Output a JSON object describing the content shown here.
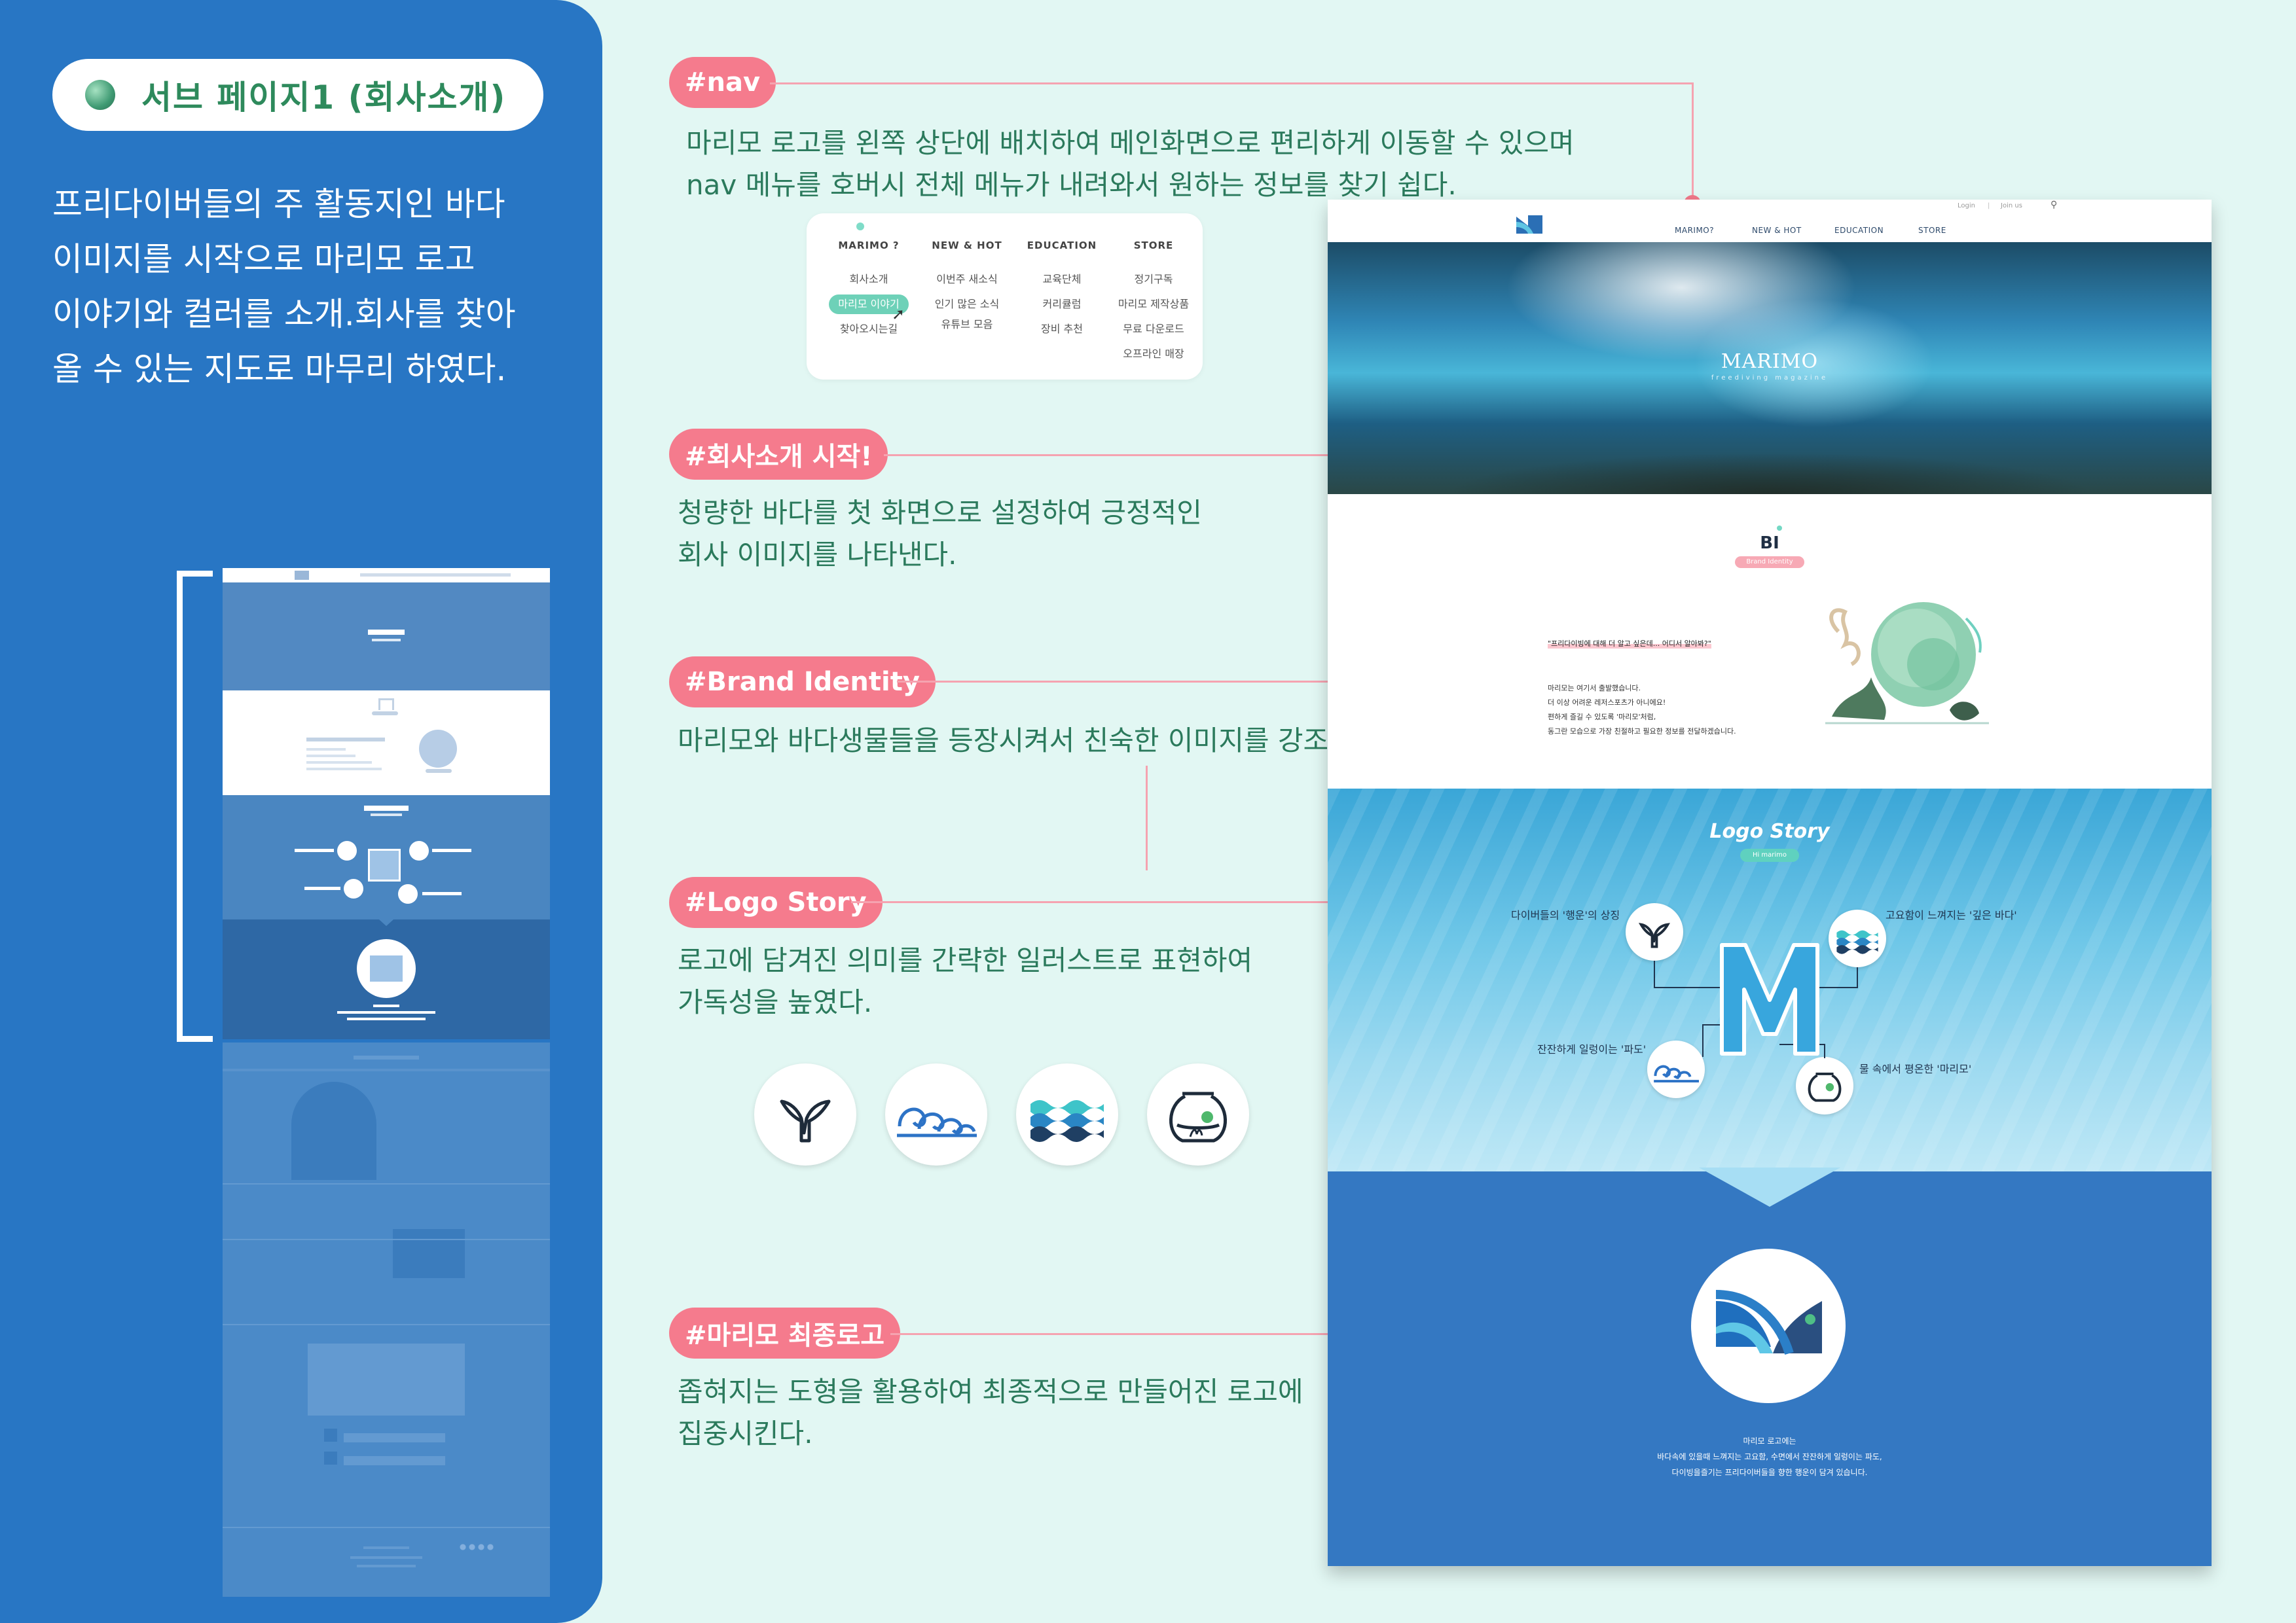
{
  "left": {
    "title": "서브 페이지1 (회사소개)",
    "intro": [
      "프리다이버들의 주 활동지인 바다",
      "이미지를 시작으로 마리모 로고",
      "이야기와 컬러를 소개.회사를 찾아",
      "올 수 있는 지도로 마무리 하였다."
    ]
  },
  "nav": {
    "tag": "#nav",
    "desc": [
      "마리모 로고를 왼쪽 상단에 배치하여 메인화면으로 편리하게 이동할 수 있으며",
      "nav 메뉴를 호버시 전체 메뉴가 내려와서 원하는 정보를 찾기 쉽다."
    ],
    "dropdown": {
      "columns": [
        {
          "head": "MARIMO ?",
          "items": [
            "회사소개",
            "마리모 이야기",
            "찾아오시는길"
          ]
        },
        {
          "head": "NEW & HOT",
          "items": [
            "이번주 새소식",
            "인기 많은 소식",
            "유튜브 모음"
          ]
        },
        {
          "head": "EDUCATION",
          "items": [
            "교육단체",
            "커리큘럼",
            "장비 추천"
          ]
        },
        {
          "head": "STORE",
          "items": [
            "정기구독",
            "마리모 제작상품",
            "무료 다운로드",
            "오프라인 매장"
          ]
        }
      ]
    }
  },
  "intro_section": {
    "tag": "#회사소개 시작!",
    "desc": [
      "청량한 바다를 첫 화면으로 설정하여 긍정적인",
      "회사 이미지를 나타낸다."
    ]
  },
  "brand": {
    "tag": "#Brand Identity",
    "desc": [
      "마리모와 바다생물들을 등장시켜서 친숙한 이미지를 강조."
    ]
  },
  "logo_story": {
    "tag": "#Logo Story",
    "desc": [
      "로고에 담겨진 의미를 간략한 일러스트로 표현하여",
      "가독성을 높였다."
    ],
    "icons": [
      "whale-tail-icon",
      "wave-curl-icon",
      "wave-layers-icon",
      "fishbowl-icon"
    ]
  },
  "final_logo": {
    "tag": "#마리모 최종로고",
    "desc": [
      "좁혀지는 도형을 활용하여 최종적으로 만들어진 로고에",
      "집중시킨다."
    ]
  },
  "site": {
    "util": {
      "login": "Login",
      "join": "Join us"
    },
    "menu": [
      "MARIMO?",
      "NEW & HOT",
      "EDUCATION",
      "STORE"
    ],
    "hero": {
      "title": "MARIMO",
      "subtitle": "freediving magazine"
    },
    "bi": {
      "title": "BI",
      "badge": "Brand Identity",
      "quote": "\"프리다이빙에 대해 더 알고 싶은데... 어디서 알아봐?\"",
      "lines": [
        "마리모는 여기서 출발했습니다.",
        "더 이상 어려운 레저스포츠가 아니에요!",
        "편하게 즐길 수 있도록 '마리모'처럼,",
        "동그란 모습으로 가장 친절하고 필요한 정보를 전달하겠습니다."
      ]
    },
    "logo_story": {
      "title": "Logo Story",
      "badge": "Hi marimo",
      "labels": [
        "다이버들의 '행운'의 상징",
        "고요함이 느껴지는 '깊은 바다'",
        "잔잔하게 일렁이는 '파도'",
        "물 속에서 평온한 '마리모'"
      ],
      "letter": "M"
    },
    "final": {
      "lines": [
        "마리모 로고에는",
        "바다속에 있을때 느껴지는 고요함, 수면에서 잔잔하게 일렁이는 파도,",
        "다이빙을즐기는 프리다이버들을 향한 행운이 담겨 있습니다."
      ]
    }
  },
  "colors": {
    "panel_blue": "#2876c4",
    "background_mint": "#e2f7f3",
    "tag_pink": "#f57b8d",
    "text_green": "#2b7a5c",
    "final_blue": "#3478c2"
  }
}
